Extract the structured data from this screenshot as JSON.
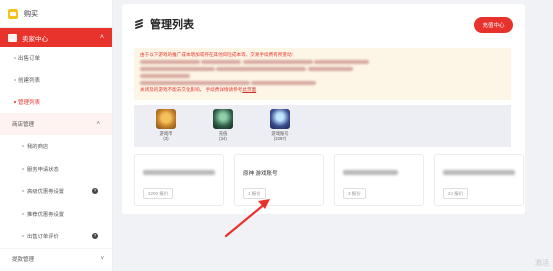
{
  "brand": {
    "name": "购买"
  },
  "sidebar": {
    "section_label": "卖家中心",
    "items": [
      {
        "label": "出售订单"
      },
      {
        "label": "创建列表"
      },
      {
        "label": "管理列表"
      }
    ],
    "store": {
      "label": "商店管理",
      "subs": [
        {
          "label": "我的商店"
        },
        {
          "label": "服务申请状态"
        },
        {
          "label": "高级优惠券设置"
        },
        {
          "label": "推荐优惠券设置"
        },
        {
          "label": "出售订单评价"
        }
      ]
    },
    "payout": {
      "label": "提款管理"
    }
  },
  "page": {
    "title": "管理列表",
    "recharge": "充值中心"
  },
  "notice": {
    "line1": "由于以下游戏的推广成本增加或存在其他风险成本等，交易手续费有所变动：",
    "line6a": "关闭及的游戏不能去交化影响。 手续费详情请参考",
    "line6b": "此页面"
  },
  "games": [
    {
      "label": "游戏币",
      "count": "(3)",
      "color": "#c9862e"
    },
    {
      "label": "充值",
      "count": "(34)",
      "color": "#2f5a46"
    },
    {
      "label": "游戏账号",
      "count": "(2297)",
      "color": "#3b4c8f"
    }
  ],
  "cards": [
    {
      "name": "",
      "tag": "2200 报价"
    },
    {
      "name": "原神 游戏账号",
      "tag": "1 报价"
    },
    {
      "name": "",
      "tag": "3 报价"
    },
    {
      "name": "",
      "tag": "24 报价"
    }
  ],
  "watermark": "激活"
}
